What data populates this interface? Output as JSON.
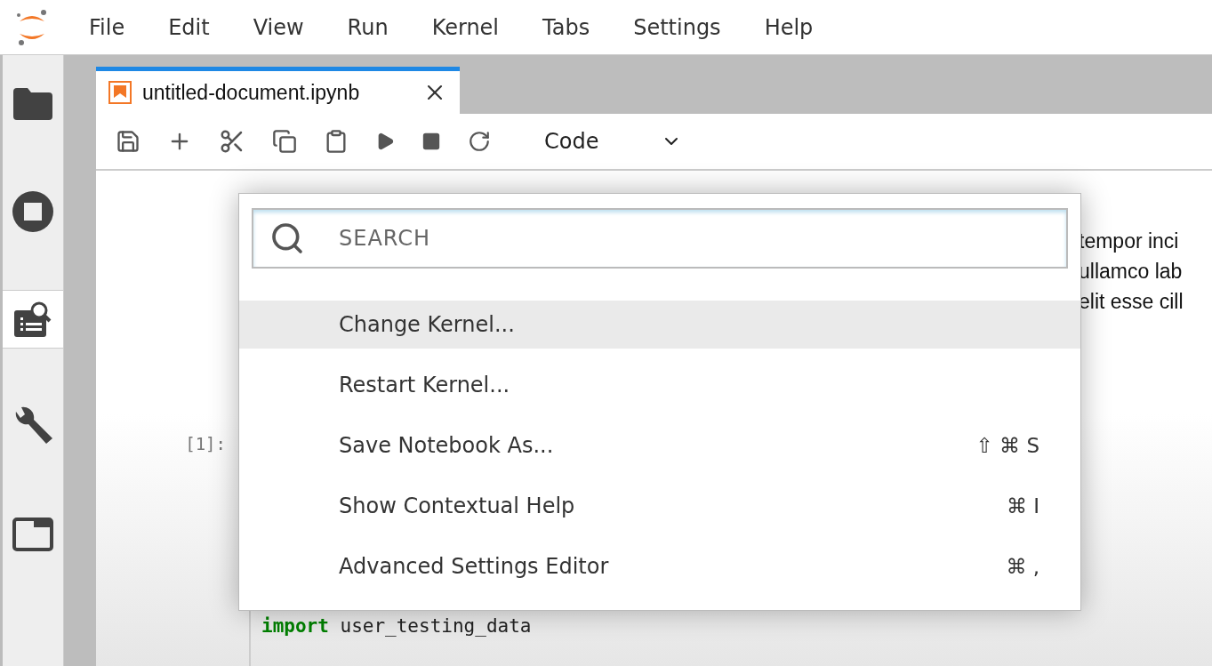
{
  "menu": [
    "File",
    "Edit",
    "View",
    "Run",
    "Kernel",
    "Tabs",
    "Settings",
    "Help"
  ],
  "sidebar": {
    "items": [
      {
        "kind": "folder",
        "selected": false
      },
      {
        "kind": "running",
        "selected": false
      },
      {
        "kind": "inspector",
        "selected": true
      },
      {
        "kind": "wrench",
        "selected": false
      },
      {
        "kind": "tabs",
        "selected": false
      }
    ]
  },
  "tab": {
    "title": "untitled-document.ipynb",
    "selected": true
  },
  "toolbar": {
    "cell_type": "Code"
  },
  "notebook": {
    "markdown_lines": [
      "tempor inci",
      "ullamco lab",
      "elit esse cill"
    ],
    "code_cell": {
      "prompt": "[1]:",
      "keyword": "import",
      "code": "user_testing_data"
    }
  },
  "palette": {
    "search": {
      "placeholder": "SEARCH"
    },
    "items": [
      {
        "label": "Change Kernel...",
        "selected": true
      },
      {
        "label": "Restart Kernel...",
        "selected": false
      },
      {
        "label": "Save Notebook As...",
        "shortcut": "⇧ ⌘ S",
        "selected": false
      },
      {
        "label": "Show Contextual Help",
        "shortcut": "⌘ I",
        "selected": false
      },
      {
        "label": "Advanced Settings Editor",
        "shortcut": "⌘ ,",
        "selected": false
      }
    ]
  }
}
